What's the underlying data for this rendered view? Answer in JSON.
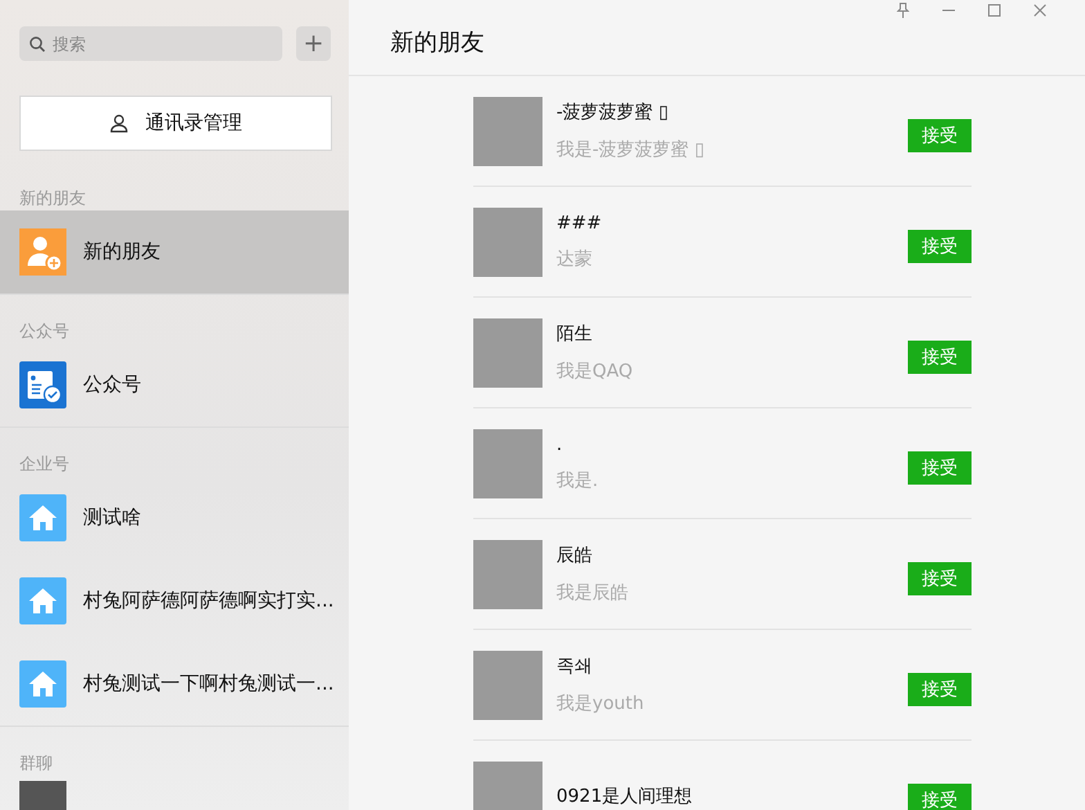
{
  "window": {
    "title": "新的朋友"
  },
  "search": {
    "placeholder": "搜索"
  },
  "add_button": "+",
  "contacts_manage_button": "通讯录管理",
  "sidebar": {
    "sections": [
      {
        "label": "新的朋友",
        "items": [
          {
            "kind": "new_friend",
            "label": "新的朋友",
            "selected": true
          }
        ]
      },
      {
        "label": "公众号",
        "items": [
          {
            "kind": "official",
            "label": "公众号",
            "selected": false
          }
        ]
      },
      {
        "label": "企业号",
        "items": [
          {
            "kind": "enterprise",
            "label": "测试啥",
            "selected": false
          },
          {
            "kind": "enterprise",
            "label": "村兔阿萨德阿萨德啊实打实...",
            "selected": false
          },
          {
            "kind": "enterprise",
            "label": "村兔测试一下啊村兔测试一...",
            "selected": false
          }
        ]
      },
      {
        "label": "群聊",
        "items": [
          {
            "kind": "group",
            "selected": false
          }
        ]
      }
    ]
  },
  "requests": [
    {
      "name": "-菠萝菠萝蜜 ▯",
      "message": "我是-菠萝菠萝蜜 ▯",
      "button": "接受"
    },
    {
      "name": "###",
      "message": "达蒙",
      "button": "接受"
    },
    {
      "name": "陌生",
      "message": "我是QAQ",
      "button": "接受"
    },
    {
      "name": ".",
      "message": "我是.",
      "button": "接受"
    },
    {
      "name": "辰皓",
      "message": "我是辰皓",
      "button": "接受"
    },
    {
      "name": "족쇄",
      "message": "我是youth",
      "button": "接受"
    },
    {
      "name": "0921是人间理想",
      "button": "接受"
    }
  ]
}
